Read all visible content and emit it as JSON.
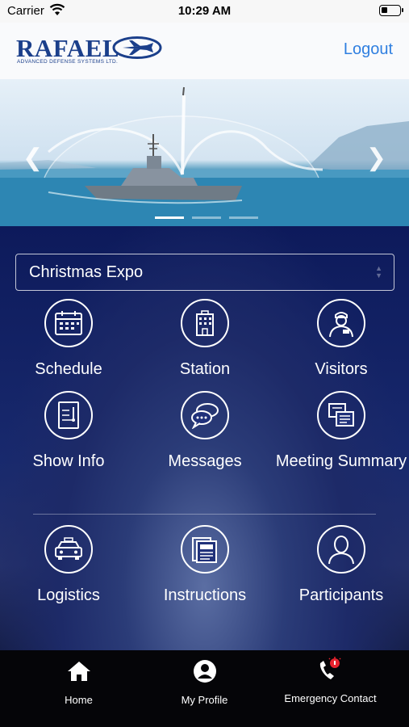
{
  "status_bar": {
    "carrier": "Carrier",
    "time": "10:29 AM"
  },
  "header": {
    "logo_text": "RAFAEL",
    "logo_subtitle": "ADVANCED DEFENSE SYSTEMS LTD.",
    "logout_label": "Logout"
  },
  "banner": {
    "slide_count": 3,
    "active_slide": 1
  },
  "event_selector": {
    "value": "Christmas Expo"
  },
  "menu": {
    "items": [
      {
        "label": "Schedule",
        "icon": "calendar-icon"
      },
      {
        "label": "Station",
        "icon": "building-icon"
      },
      {
        "label": "Visitors",
        "icon": "visitor-icon"
      },
      {
        "label": "Show Info",
        "icon": "document-icon"
      },
      {
        "label": "Messages",
        "icon": "chat-icon"
      },
      {
        "label": "Meeting Summary",
        "icon": "notes-icon"
      },
      {
        "label": "Logistics",
        "icon": "taxi-icon"
      },
      {
        "label": "Instructions",
        "icon": "newspaper-icon"
      },
      {
        "label": "Participants",
        "icon": "person-icon"
      }
    ]
  },
  "tabbar": {
    "items": [
      {
        "label": "Home",
        "icon": "home-icon"
      },
      {
        "label": "My Profile",
        "icon": "profile-icon"
      },
      {
        "label": "Emergency Contact",
        "icon": "emergency-phone-icon"
      }
    ]
  },
  "colors": {
    "accent": "#2f7fe0",
    "brand": "#1b3f8b",
    "background": "#0b1645",
    "alert": "#e8232e"
  }
}
